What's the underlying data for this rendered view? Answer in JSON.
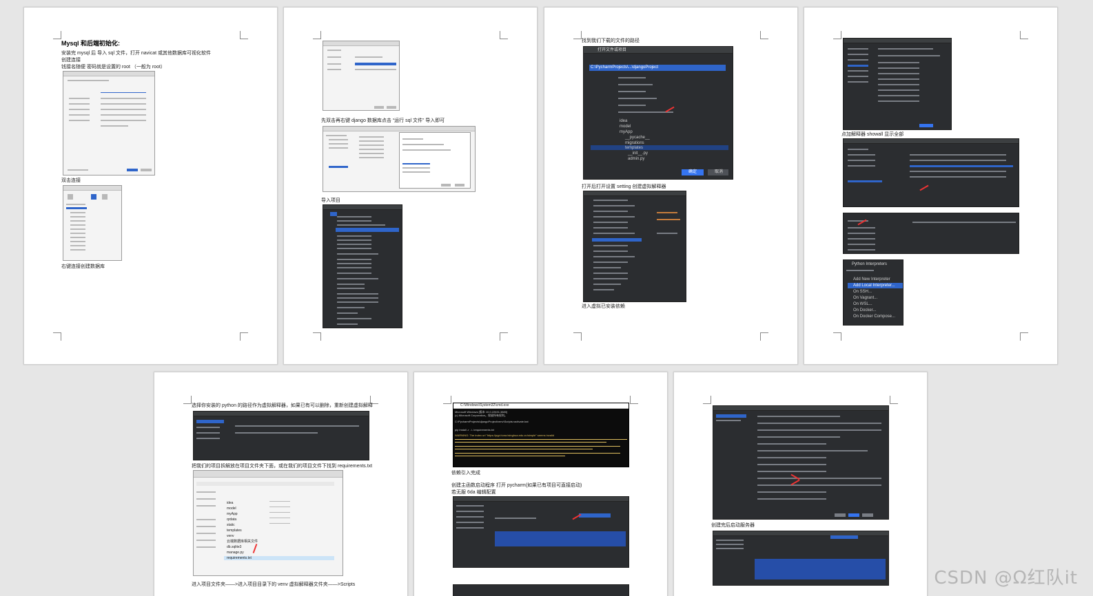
{
  "pages": [
    {
      "lines": [
        "Mysql 和后端初始化:",
        "安装完 mysql 后    导入 sql 文件，打开 navicat 或其他数据库可视化软件",
        "创建连接",
        "钱接名随便   密码就是设置的 root  （一般为 root）",
        "双击连接",
        "右键连接创建数据库"
      ]
    },
    {
      "lines": [
        "先双击再右键 django 数据库点击 “运行 sql 文件” 导入即可",
        "导入项目"
      ]
    },
    {
      "lines": [
        "找到我们下载的文件的路径",
        "打开后打开设置 setting 创建虚拟解释器",
        "进入虚拟已安装依赖"
      ],
      "dialog_title": "打开文件或项目",
      "path_value": "C:\\PycharmProjects\\...\\djangoProject",
      "tree_items": [
        "idea",
        "model",
        "myApp",
        "__pycache__",
        "migrations",
        "templates",
        "__init__.py",
        "admin.py"
      ],
      "ok_label": "确定",
      "cancel_label": "取消"
    },
    {
      "lines": [
        "点加解释器   showall  显示全部"
      ],
      "popup_title": "Python Interpreters",
      "popup_items": [
        "Add New Interpreter",
        "Add Local Interpreter...",
        "On SSH...",
        "On Vagrant...",
        "On WSL...",
        "On Docker...",
        "On Docker Compose..."
      ]
    },
    {
      "lines": [
        "选择你安装的 python 的路径作为虚拟解释器，如果已有可以删除，重新创建虚拟解释",
        "把我们的项目拆解放在项目文件夹下面，或在我们的项目文件下找到 requirements.txt",
        "进入项目文件夹——>进入项目目录下的 venv 虚拟解释器文件夹——>Scripts"
      ],
      "file_list": [
        "idea",
        "model",
        "myApp",
        "qrdata",
        "static",
        "templates",
        "venv",
        "云端数据库相关文件",
        "db.sqlite3",
        "manage.py",
        "requirements.txt"
      ]
    },
    {
      "lines": [
        "依赖引入完成",
        "创建主函数启动程序     打开 pycharm(如果已有项目可直接启动)",
        "若无服 6da 编辑配置"
      ],
      "console_title": "C:\\Windows\\System32\\cmd.exe",
      "console_lines": [
        "Microsoft Windows [版本 10.0.22631.3880]",
        "(c) Microsoft Corporation。保留所有权利。",
        "C:\\PycharmProjects\\djangoProject\\venv\\Scripts>activate.bat",
        "pip install -r ..\\..\\requirements.txt",
        "WARNING: The index url \"https://pypi.tuna.tsinghua.edu.cn/simple\" seems invalid"
      ]
    },
    {
      "lines": [
        "创建完后启动服务器"
      ]
    }
  ],
  "watermark": "CSDN @Ω红队it"
}
